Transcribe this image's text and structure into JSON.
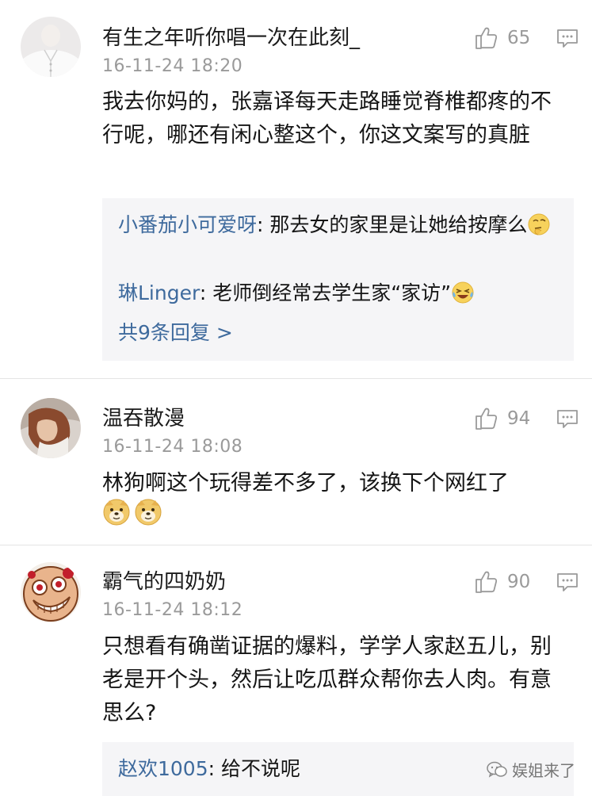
{
  "comments": [
    {
      "username": "有生之年听你唱一次在此刻_",
      "timestamp": "16-11-24 18:20",
      "likes": "65",
      "text": "我去你妈的，张嘉译每天走路睡觉脊椎都疼的不行呢，哪还有闲心整这个，你这文案写的真脏",
      "avatar_icon": "white-shirt-avatar",
      "replies": [
        {
          "user": "小番茄小可爱呀",
          "sep": ": ",
          "text": "那去女的家里是让她给按摩么",
          "emoji": "thinking-emoji"
        },
        {
          "user": "琳Linger",
          "sep": ": ",
          "text": "老师倒经常去学生家“家访”",
          "emoji": "laughing-tears-emoji"
        }
      ],
      "more_replies": "共9条回复 >"
    },
    {
      "username": "温吞散漫",
      "timestamp": "16-11-24 18:08",
      "likes": "94",
      "text": "林狗啊这个玩得差不多了，该换下个网红了",
      "avatar_icon": "photo-avatar",
      "emojis": [
        "doge-emoji",
        "doge-emoji"
      ]
    },
    {
      "username": "霸气的四奶奶",
      "timestamp": "16-11-24 18:12",
      "likes": "90",
      "text": "只想看有确凿证据的爆料，学学人家赵五儿，别老是开个头，然后让吃瓜群众帮你去人肉。有意思么?",
      "avatar_icon": "cartoon-face-avatar",
      "replies": [
        {
          "user": "赵欢1005",
          "sep": ": ",
          "text": "给不说呢"
        }
      ]
    }
  ],
  "watermark": {
    "text": "娱姐来了"
  },
  "colors": {
    "link": "#3e6a9d",
    "muted": "#9a9a9a",
    "reply_bg": "#f5f5f7"
  }
}
